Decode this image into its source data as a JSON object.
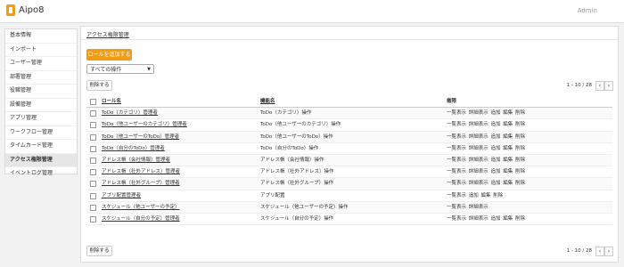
{
  "header": {
    "logo": "Aipo8",
    "user": "Admin"
  },
  "sidebar": {
    "items": [
      {
        "label": "基本情報"
      },
      {
        "label": "インポート"
      },
      {
        "label": "ユーザー管理"
      },
      {
        "label": "部署管理"
      },
      {
        "label": "役職管理"
      },
      {
        "label": "設備管理"
      },
      {
        "label": "アプリ管理"
      },
      {
        "label": "ワークフロー管理"
      },
      {
        "label": "タイムカード管理"
      },
      {
        "label": "アクセス権限管理",
        "active": true
      },
      {
        "label": "イベントログ管理"
      }
    ]
  },
  "main": {
    "breadcrumb": "アクセス権限管理",
    "add_button": "ロールを追加する",
    "filter_select": "すべての操作",
    "delete_button": "削除する",
    "pagination": {
      "text": "1 - 10 / 28",
      "prev": "‹",
      "next": "›"
    },
    "columns": {
      "role": "ロール名",
      "feature": "機能名",
      "permission": "権限"
    },
    "rows": [
      {
        "role": "ToDo（カテゴリ）管理者",
        "feature": "ToDo（カテゴリ）操作",
        "permission": "一覧表示 詳細表示 追加 編集 削除"
      },
      {
        "role": "ToDo（他ユーザーのカテゴリ）管理者",
        "feature": "ToDo（他ユーザーのカテゴリ）操作",
        "permission": "一覧表示 詳細表示 追加 編集 削除"
      },
      {
        "role": "ToDo（他ユーザーのToDo）管理者",
        "feature": "ToDo（他ユーザーのToDo）操作",
        "permission": "一覧表示 詳細表示 追加 編集 削除"
      },
      {
        "role": "ToDo（自分のToDo）管理者",
        "feature": "ToDo（自分のToDo）操作",
        "permission": "一覧表示 詳細表示 追加 編集 削除"
      },
      {
        "role": "アドレス帳（会社情報）管理者",
        "feature": "アドレス帳（会社情報）操作",
        "permission": "一覧表示 詳細表示 追加 編集 削除"
      },
      {
        "role": "アドレス帳（社外アドレス）管理者",
        "feature": "アドレス帳（社外アドレス）操作",
        "permission": "一覧表示 詳細表示 追加 編集 削除"
      },
      {
        "role": "アドレス帳（社外グループ）管理者",
        "feature": "アドレス帳（社外グループ）操作",
        "permission": "一覧表示 詳細表示 追加 編集 削除"
      },
      {
        "role": "アプリ配置管理者",
        "feature": "アプリ配置",
        "permission": "一覧表示 追加 編集 削除"
      },
      {
        "role": "スケジュール（他ユーザーの予定）",
        "feature": "スケジュール（他ユーザーの予定）操作",
        "permission": "一覧表示 詳細表示"
      },
      {
        "role": "スケジュール（自分の予定）管理者",
        "feature": "スケジュール（自分の予定）操作",
        "permission": "一覧表示 詳細表示 追加 編集 削除"
      }
    ]
  }
}
